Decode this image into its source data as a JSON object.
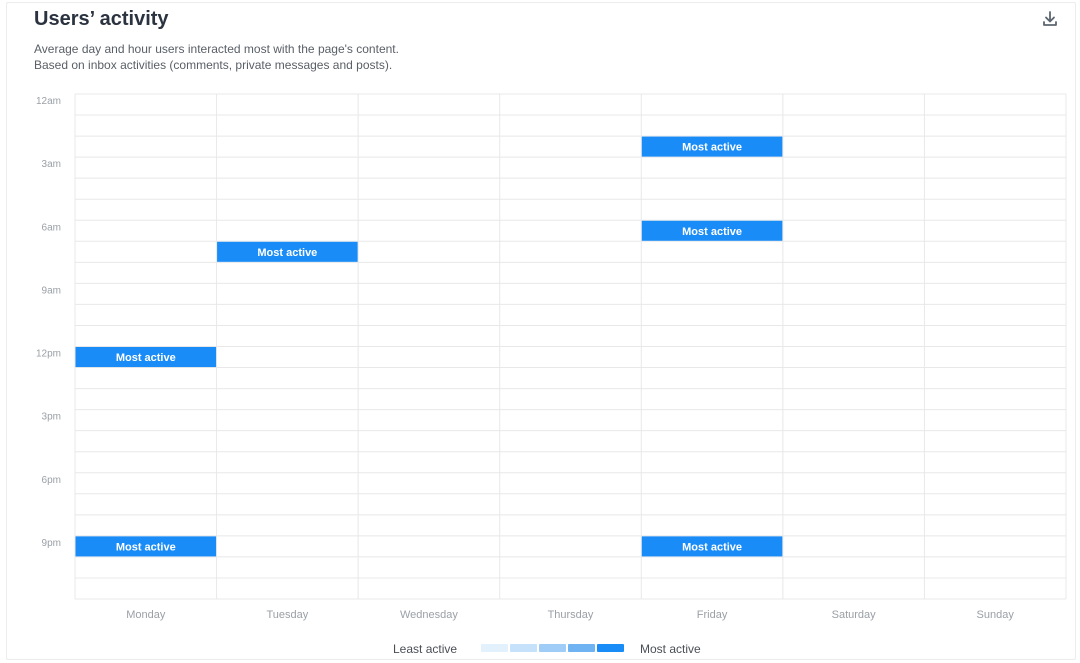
{
  "header": {
    "title": "Users’ activity",
    "subtitle_line1": "Average day and hour users interacted most with the page's content.",
    "subtitle_line2": "Based on inbox activities (comments, private messages and posts).",
    "download_icon": "download-icon"
  },
  "colors": {
    "most_active": "#1a8cf7",
    "grid": "#e8e8e8",
    "axis_text": "#9aa0a6",
    "legend_scale": [
      "#e3f1fd",
      "#c6e2fb",
      "#9fcdf8",
      "#6fb3f3",
      "#1a8cf7"
    ]
  },
  "legend": {
    "min_label": "Least active",
    "max_label": "Most active"
  },
  "chart_data": {
    "type": "heatmap",
    "title": "Users’ activity",
    "days": [
      "Monday",
      "Tuesday",
      "Wednesday",
      "Thursday",
      "Friday",
      "Saturday",
      "Sunday"
    ],
    "hour_tick_labels": [
      "12am",
      "3am",
      "6am",
      "9am",
      "12pm",
      "3pm",
      "6pm",
      "9pm"
    ],
    "hour_tick_values": [
      0,
      3,
      6,
      9,
      12,
      15,
      18,
      21
    ],
    "hours_per_day": 24,
    "grid": true,
    "cells": [
      {
        "day": "Friday",
        "hour": 2,
        "level": "most",
        "label": "Most active"
      },
      {
        "day": "Friday",
        "hour": 6,
        "level": "most",
        "label": "Most active"
      },
      {
        "day": "Tuesday",
        "hour": 7,
        "level": "most",
        "label": "Most active"
      },
      {
        "day": "Monday",
        "hour": 12,
        "level": "most",
        "label": "Most active"
      },
      {
        "day": "Monday",
        "hour": 21,
        "level": "most",
        "label": "Most active"
      },
      {
        "day": "Friday",
        "hour": 21,
        "level": "most",
        "label": "Most active"
      }
    ],
    "legend_position": "bottom"
  }
}
